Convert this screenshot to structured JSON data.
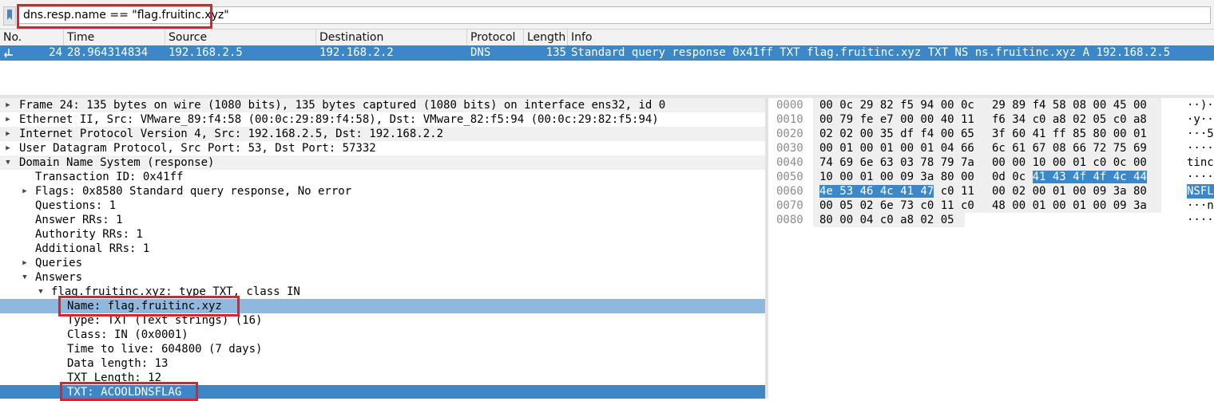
{
  "filter": {
    "value": "dns.resp.name == \"flag.fruitinc.xyz\""
  },
  "packet_list": {
    "columns": [
      "No.",
      "Time",
      "Source",
      "Destination",
      "Protocol",
      "Length",
      "Info"
    ],
    "row": {
      "no": "24",
      "time": "28.964314834",
      "source": "192.168.2.5",
      "destination": "192.168.2.2",
      "protocol": "DNS",
      "length": "135",
      "info": "Standard query response 0x41ff TXT flag.fruitinc.xyz TXT NS ns.fruitinc.xyz A 192.168.2.5"
    }
  },
  "details": [
    {
      "text": "Frame 24: 135 bytes on wire (1080 bits), 135 bytes captured (1080 bits) on interface ens32, id 0",
      "arrow": "collapsed"
    },
    {
      "text": "Ethernet II, Src: VMware_89:f4:58 (00:0c:29:89:f4:58), Dst: VMware_82:f5:94 (00:0c:29:82:f5:94)",
      "arrow": "collapsed"
    },
    {
      "text": "Internet Protocol Version 4, Src: 192.168.2.5, Dst: 192.168.2.2",
      "arrow": "collapsed"
    },
    {
      "text": "User Datagram Protocol, Src Port: 53, Dst Port: 57332",
      "arrow": "collapsed"
    },
    {
      "text": "Domain Name System (response)",
      "arrow": "expanded"
    },
    {
      "text": "Transaction ID: 0x41ff",
      "arrow": "none"
    },
    {
      "text": "Flags: 0x8580 Standard query response, No error",
      "arrow": "collapsed"
    },
    {
      "text": "Questions: 1",
      "arrow": "none"
    },
    {
      "text": "Answer RRs: 1",
      "arrow": "none"
    },
    {
      "text": "Authority RRs: 1",
      "arrow": "none"
    },
    {
      "text": "Additional RRs: 1",
      "arrow": "none"
    },
    {
      "text": "Queries",
      "arrow": "collapsed"
    },
    {
      "text": "Answers",
      "arrow": "expanded"
    },
    {
      "text": "flag.fruitinc.xyz: type TXT, class IN",
      "arrow": "expanded"
    },
    {
      "text": "Name: flag.fruitinc.xyz",
      "arrow": "none"
    },
    {
      "text": "Type: TXT (Text strings) (16)",
      "arrow": "none"
    },
    {
      "text": "Class: IN (0x0001)",
      "arrow": "none"
    },
    {
      "text": "Time to live: 604800 (7 days)",
      "arrow": "none"
    },
    {
      "text": "Data length: 13",
      "arrow": "none"
    },
    {
      "text": "TXT Length: 12",
      "arrow": "none"
    },
    {
      "text": "TXT: ACOOLDNSFLAG",
      "arrow": "none"
    }
  ],
  "bytes": [
    {
      "offset": "0000",
      "hex1": "00 0c 29 82 f5 94 00 0c",
      "hex2": "29 89 f4 58 08 00 45 00",
      "ascii": "··)·"
    },
    {
      "offset": "0010",
      "hex1": "00 79 fe e7 00 00 40 11",
      "hex2": "f6 34 c0 a8 02 05 c0 a8",
      "ascii": "·y··"
    },
    {
      "offset": "0020",
      "hex1": "02 02 00 35 df f4 00 65",
      "hex2": "3f 60 41 ff 85 80 00 01",
      "ascii": "···5"
    },
    {
      "offset": "0030",
      "hex1": "00 01 00 01 00 01 04 66",
      "hex2": "6c 61 67 08 66 72 75 69",
      "ascii": "····"
    },
    {
      "offset": "0040",
      "hex1": "74 69 6e 63 03 78 79 7a",
      "hex2": "00 00 10 00 01 c0 0c 00",
      "ascii": "tinc"
    },
    {
      "offset": "0050",
      "hex1": "10 00 01 00 09 3a 80 00",
      "hex2a": "0d 0c",
      "hex2b": "41 43 4f 4f 4c 44",
      "ascii": "····"
    },
    {
      "offset": "0060",
      "hex1a": "4e 53 46 4c 41 47",
      "hex1b": "c0 11",
      "hex2": "00 02 00 01 00 09 3a 80",
      "ascii": "NSFL"
    },
    {
      "offset": "0070",
      "hex1": "00 05 02 6e 73 c0 11 c0",
      "hex2": "48 00 01 00 01 00 09 3a",
      "ascii": "···n"
    },
    {
      "offset": "0080",
      "hex1": "80 00 04 c0 a8 02 05",
      "ascii": "····"
    }
  ]
}
